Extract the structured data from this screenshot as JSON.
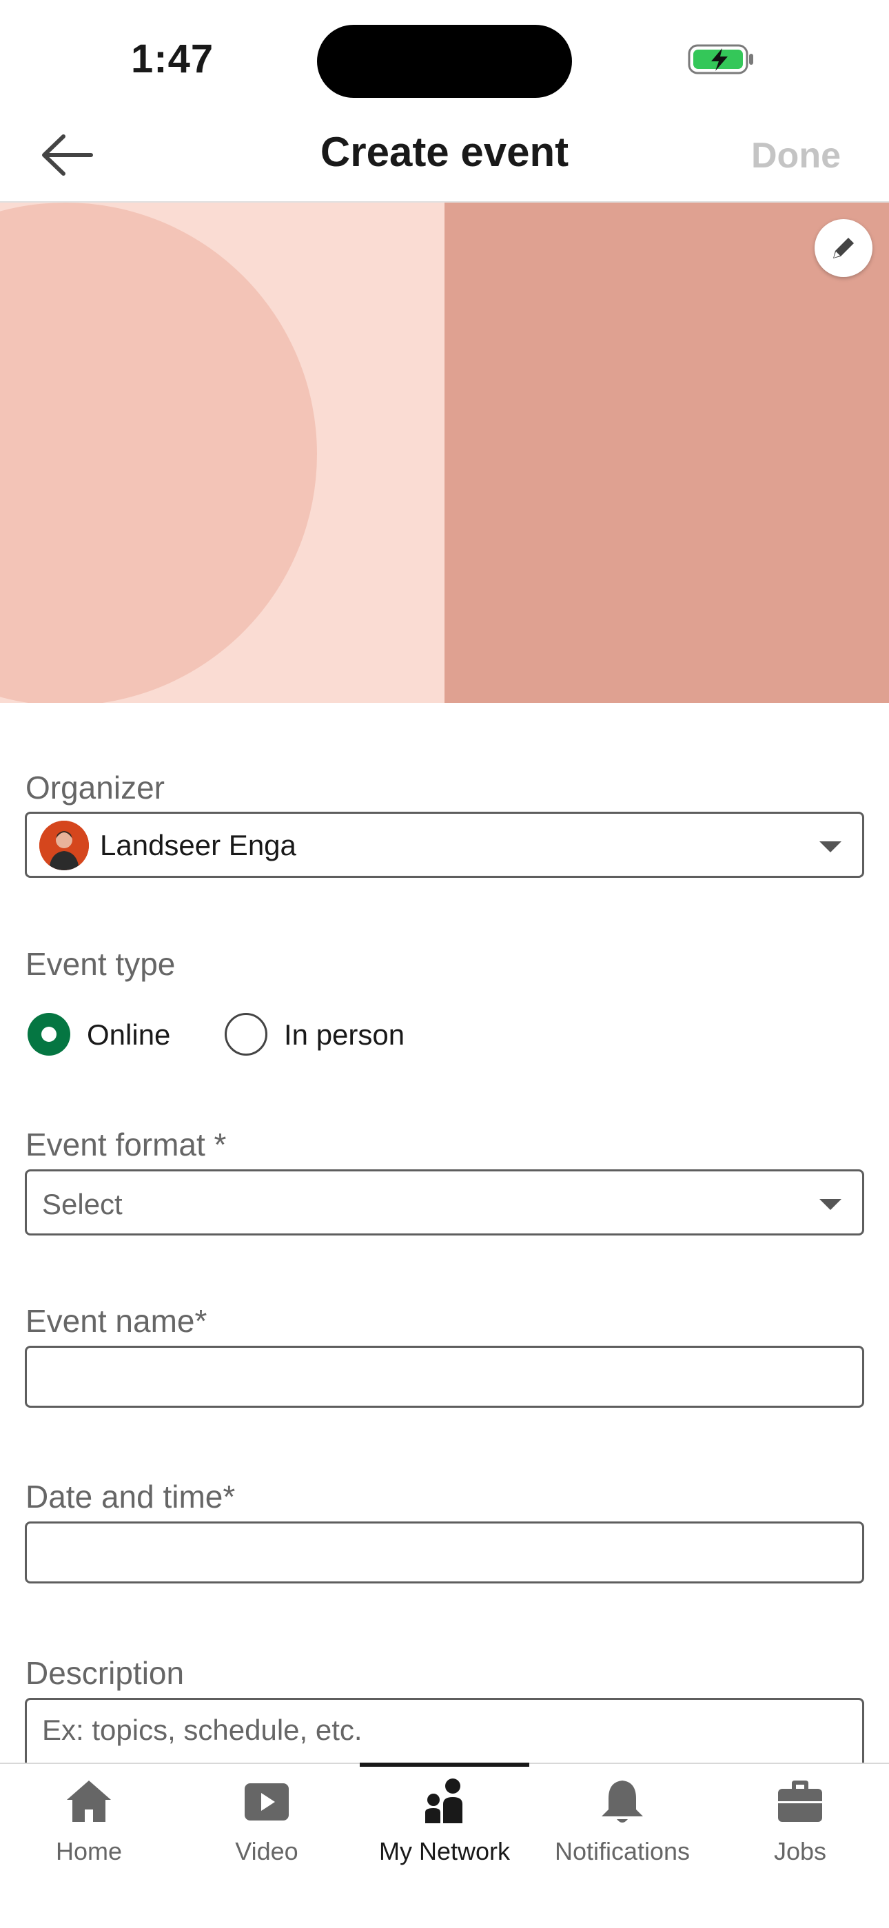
{
  "status_bar": {
    "time": "1:47"
  },
  "header": {
    "title": "Create event",
    "done_label": "Done"
  },
  "banner": {
    "edit_icon": "pencil-icon"
  },
  "form": {
    "organizer": {
      "label": "Organizer",
      "value": "Landseer Enga"
    },
    "event_type": {
      "label": "Event type",
      "options": [
        "Online",
        "In person"
      ],
      "selected": "Online"
    },
    "event_format": {
      "label": "Event format *",
      "value": "Select"
    },
    "event_name": {
      "label": "Event name*",
      "value": ""
    },
    "date_time": {
      "label": "Date and time*",
      "value": ""
    },
    "description": {
      "label": "Description",
      "placeholder": "Ex: topics, schedule, etc."
    }
  },
  "tabs": [
    {
      "label": "Home",
      "icon": "home-icon"
    },
    {
      "label": "Video",
      "icon": "video-icon"
    },
    {
      "label": "My Network",
      "icon": "my-network-icon",
      "active": true
    },
    {
      "label": "Notifications",
      "icon": "bell-icon"
    },
    {
      "label": "Jobs",
      "icon": "briefcase-icon"
    }
  ],
  "colors": {
    "accent_green": "#057642",
    "banner_light": "#fadcd3",
    "banner_dark": "#dfa191",
    "banner_circle": "#f3c4b7"
  }
}
